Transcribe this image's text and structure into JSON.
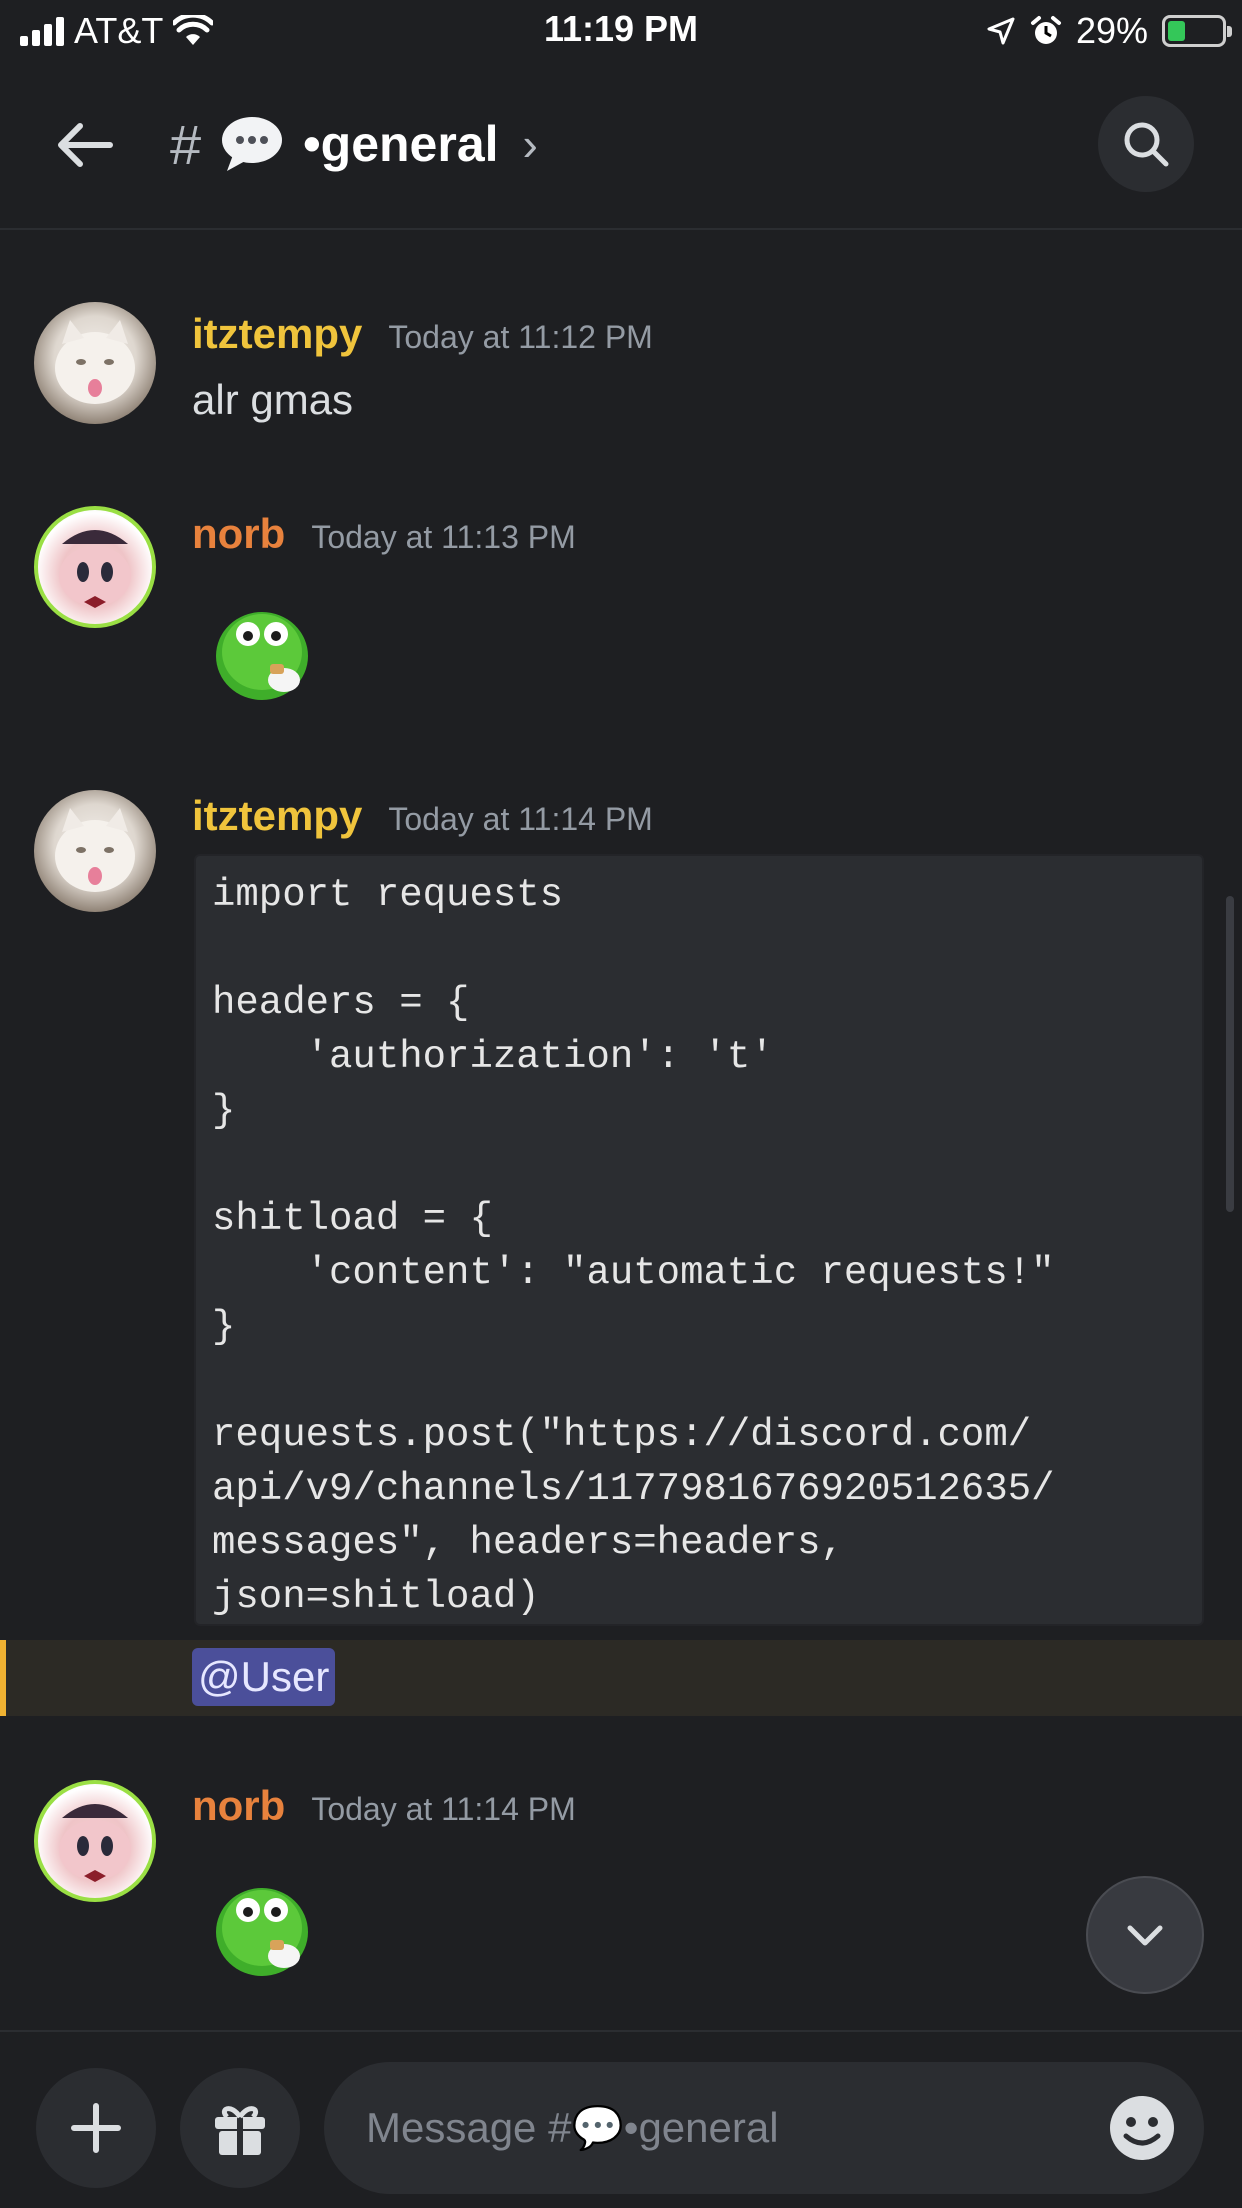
{
  "status_bar": {
    "carrier": "AT&T",
    "time": "11:19 PM",
    "battery_percent": "29%",
    "icons": [
      "cellular-signal-icon",
      "wifi-icon",
      "location-arrow-icon",
      "alarm-icon",
      "battery-charging-icon"
    ]
  },
  "header": {
    "hash": "#",
    "channel_name": "•general",
    "chevron": "›",
    "icons": [
      "back-arrow-icon",
      "speech-bubble-icon",
      "search-icon"
    ]
  },
  "messages": [
    {
      "username": "itztempy",
      "timestamp": "Today at 11:12 PM",
      "text": "alr gmas",
      "color": "#f0c43c"
    },
    {
      "username": "norb",
      "timestamp": "Today at 11:13 PM",
      "emoji": "green-blob-emoji",
      "color": "#e8823d"
    },
    {
      "username": "itztempy",
      "timestamp": "Today at 11:14 PM",
      "code": "import requests\n\nheaders = {\n    'authorization': 't'\n}\n\nshitload = {\n    'content': \"automatic requests!\"\n}\n\nrequests.post(\"https://discord.com/\napi/v9/channels/1177981676920512635/\nmessages\", headers=headers,\njson=shitload)",
      "mention": "@User",
      "color": "#f0c43c"
    },
    {
      "username": "norb",
      "timestamp": "Today at 11:14 PM",
      "emoji": "green-blob-emoji",
      "color": "#e8823d"
    }
  ],
  "composer": {
    "placeholder_prefix": "Message #",
    "placeholder_suffix": "•general",
    "icons": [
      "plus-icon",
      "gift-icon",
      "emoji-icon",
      "chevron-down-icon"
    ]
  },
  "colors": {
    "background": "#1e1f22",
    "surface": "#2b2d31",
    "mention_highlight": "#4b4f9a",
    "mention_bar": "#f0b232"
  }
}
